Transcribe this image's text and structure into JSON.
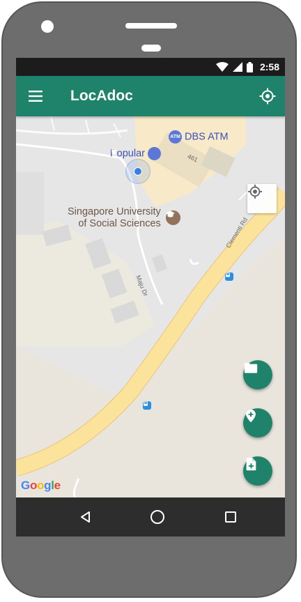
{
  "status_bar": {
    "time": "2:58"
  },
  "toolbar": {
    "title": "LocAdoc"
  },
  "map": {
    "poi": {
      "popular": "Popular",
      "dbs_atm": "DBS ATM",
      "atm_badge": "ATM",
      "building_number": "461",
      "suss_line1": "Singapore University",
      "suss_line2": "of Social Sciences"
    },
    "roads": {
      "clementi": "Clementi Rd",
      "maju": "Maju Dr"
    },
    "attribution": [
      "G",
      "o",
      "o",
      "g",
      "l",
      "e"
    ],
    "attribution_colors": [
      "#4285f4",
      "#ea4335",
      "#fbbc05",
      "#4285f4",
      "#34a853",
      "#ea4335"
    ]
  },
  "fabs": [
    "folder-icon",
    "add-location-icon",
    "add-document-icon"
  ],
  "colors": {
    "primary": "#1e836a",
    "status_bar": "#1c1c1c",
    "nav_bar": "#2d2d2d",
    "road": "#fbe39b"
  }
}
